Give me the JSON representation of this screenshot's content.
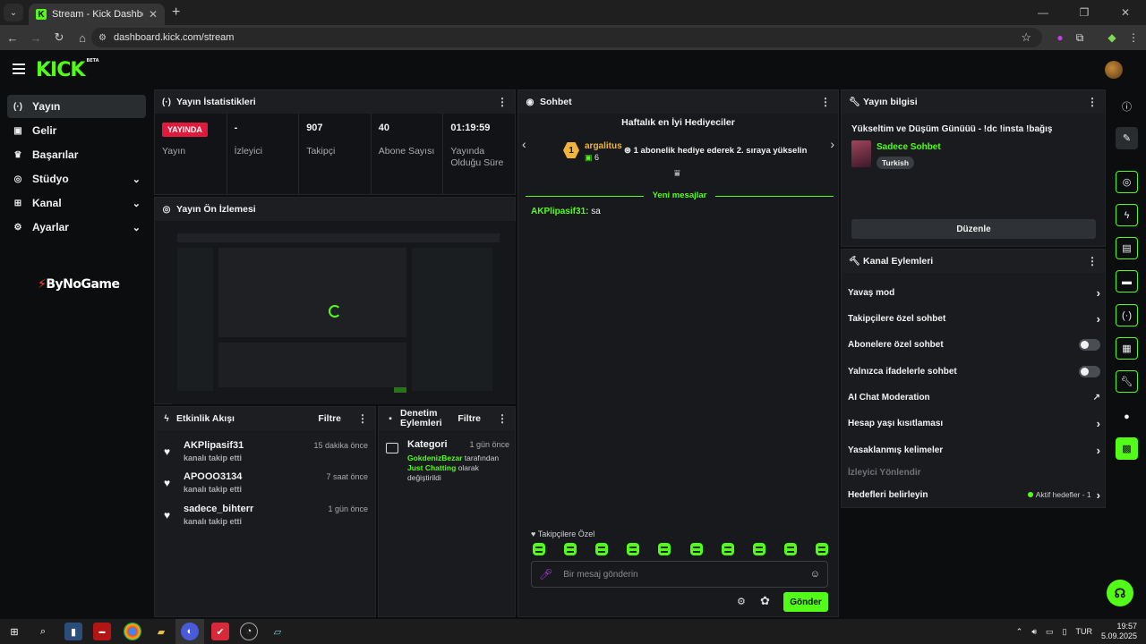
{
  "browser": {
    "tab_title": "Stream - Kick Dashboard",
    "url": "dashboard.kick.com/stream"
  },
  "brand": {
    "logo": "KICK",
    "beta": "BETA",
    "accent": "#53fc18"
  },
  "sidebar": {
    "items": [
      {
        "label": "Yayın",
        "icon": "broadcast-icon"
      },
      {
        "label": "Gelir",
        "icon": "revenue-icon"
      },
      {
        "label": "Başarılar",
        "icon": "trophy-icon"
      },
      {
        "label": "Stüdyo",
        "icon": "studio-icon"
      },
      {
        "label": "Kanal",
        "icon": "channel-icon"
      },
      {
        "label": "Ayarlar",
        "icon": "gear-icon"
      }
    ],
    "sponsor": "ByNoGame"
  },
  "stats": {
    "title": "Yayın İstatistikleri",
    "items": [
      {
        "value": "YAYINDA",
        "label": "Yayın"
      },
      {
        "value": "-",
        "label": "İzleyici"
      },
      {
        "value": "907",
        "label": "Takipçi"
      },
      {
        "value": "40",
        "label": "Abone Sayısı"
      },
      {
        "value": "01:19:59",
        "label": "Yayında Olduğu Süre"
      }
    ]
  },
  "preview": {
    "title": "Yayın Ön İzlemesi"
  },
  "activity": {
    "title": "Etkinlik Akışı",
    "filter": "Filtre",
    "items": [
      {
        "name": "AKPlipasif31",
        "sub": "kanalı takip etti",
        "time": "15 dakika önce"
      },
      {
        "name": "APOOO3134",
        "sub": "kanalı takip etti",
        "time": "7 saat önce"
      },
      {
        "name": "sadece_bihterr",
        "sub": "kanalı takip etti",
        "time": "1 gün önce"
      }
    ]
  },
  "moderation": {
    "title": "Denetim Eylemleri",
    "filter": "Filtre",
    "item": {
      "type": "Kategori",
      "time": "1 gün önce",
      "actor": "GokdenizBezar",
      "by": "tarafından",
      "category": "Just Chatting",
      "rest": "olarak değiştirildi"
    }
  },
  "chat": {
    "title": "Sohbet",
    "gifters_title": "Haftalık en İyi Hediyeciler",
    "gifter": {
      "rank": "1",
      "name": "argalitus",
      "count": "6"
    },
    "gift_message": "1 abonelik hediye ederek 2. sıraya yükselin",
    "new_messages": "Yeni mesajlar",
    "messages": [
      {
        "user": "AKPlipasif31:",
        "text": "sa"
      }
    ],
    "followers_only": "Takipçilere Özel",
    "placeholder": "Bir mesaj gönderin",
    "send": "Gönder"
  },
  "stream_info": {
    "title": "Yayın bilgisi",
    "stream_title": "Yükseltim ve Düşüm Günüüü - !dc !insta !bağış",
    "category": "Sadece Sohbet",
    "tag": "Turkish",
    "edit": "Düzenle"
  },
  "channel_actions": {
    "title": "Kanal Eylemleri",
    "items": [
      {
        "label": "Yavaş mod",
        "control": "chevron"
      },
      {
        "label": "Takipçilere özel sohbet",
        "control": "chevron"
      },
      {
        "label": "Abonelere özel sohbet",
        "control": "toggle",
        "on": false
      },
      {
        "label": "Yalnızca ifadelerle sohbet",
        "control": "toggle",
        "on": false
      },
      {
        "label": "AI Chat Moderation",
        "control": "external"
      },
      {
        "label": "Hesap yaşı kısıtlaması",
        "control": "chevron"
      },
      {
        "label": "Yasaklanmış kelimeler",
        "control": "chevron"
      },
      {
        "label": "İzleyici Yönlendir",
        "control": "none",
        "disabled": true
      },
      {
        "label": "Hedefleri belirleyin",
        "control": "chevron",
        "status": "Aktif hedefler - 1"
      }
    ]
  },
  "taskbar": {
    "lang": "TUR",
    "time": "19:57",
    "date": "5.09.2025"
  }
}
